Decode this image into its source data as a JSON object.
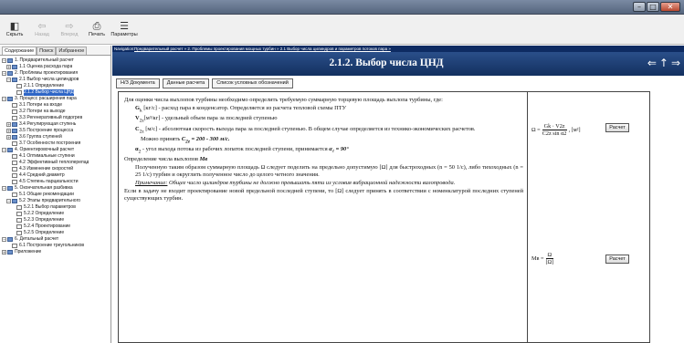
{
  "window": {
    "controls": [
      "–",
      "□",
      "✕"
    ]
  },
  "toolbar": {
    "buttons": [
      {
        "label": "Скрыть",
        "icon": "hide-panel-icon",
        "glyph": "◧",
        "enabled": true
      },
      {
        "label": "Назад",
        "icon": "back-arrow-icon",
        "glyph": "⇦",
        "enabled": false
      },
      {
        "label": "Вперед",
        "icon": "forward-arrow-icon",
        "glyph": "⇨",
        "enabled": false
      },
      {
        "label": "Печать",
        "icon": "print-icon",
        "glyph": "⎙",
        "enabled": true
      },
      {
        "label": "Параметры",
        "icon": "options-icon",
        "glyph": "☰",
        "enabled": true
      }
    ]
  },
  "left_panel": {
    "tabs": [
      "Содержание",
      "Поиск",
      "Избранное"
    ],
    "tree": [
      {
        "label": "1. Предварительный расчет",
        "level": 0,
        "exp": "−",
        "icon": "book"
      },
      {
        "label": "1.1 Оценка расхода пара",
        "level": 1,
        "exp": "+",
        "icon": "book"
      },
      {
        "label": "2. Проблемы проектирования",
        "level": 0,
        "exp": "−",
        "icon": "book"
      },
      {
        "label": "2.1 Выбор числа цилиндров",
        "level": 1,
        "exp": "−",
        "icon": "book"
      },
      {
        "label": "2.1.1 Определение",
        "level": 2,
        "exp": "",
        "icon": "page"
      },
      {
        "label": "2.1.2 Выбор числа ЦНД",
        "level": 2,
        "exp": "",
        "icon": "page",
        "selected": true
      },
      {
        "label": "3. Процесс расширения пара",
        "level": 0,
        "exp": "−",
        "icon": "book"
      },
      {
        "label": "3.1 Потери на входе",
        "level": 1,
        "exp": "",
        "icon": "page"
      },
      {
        "label": "3.2 Потери на выходе",
        "level": 1,
        "exp": "",
        "icon": "page"
      },
      {
        "label": "3.3 Регенеративный подогрев",
        "level": 1,
        "exp": "",
        "icon": "page"
      },
      {
        "label": "3.4 Регулирующая ступень",
        "level": 1,
        "exp": "+",
        "icon": "book"
      },
      {
        "label": "3.5 Построение процесса",
        "level": 1,
        "exp": "+",
        "icon": "book"
      },
      {
        "label": "3.6 Группа ступеней",
        "level": 1,
        "exp": "+",
        "icon": "book"
      },
      {
        "label": "3.7 Особенности построения",
        "level": 1,
        "exp": "",
        "icon": "page"
      },
      {
        "label": "4. Ориентировочный расчет",
        "level": 0,
        "exp": "−",
        "icon": "book"
      },
      {
        "label": "4.1 Оптимальные ступени",
        "level": 1,
        "exp": "",
        "icon": "page"
      },
      {
        "label": "4.2 Эффективный теплоперепад",
        "level": 1,
        "exp": "",
        "icon": "page"
      },
      {
        "label": "4.3 Изменение скоростей",
        "level": 1,
        "exp": "",
        "icon": "page"
      },
      {
        "label": "4.4 Средний диаметр",
        "level": 1,
        "exp": "",
        "icon": "page"
      },
      {
        "label": "4.5 Степень парциальности",
        "level": 1,
        "exp": "",
        "icon": "page"
      },
      {
        "label": "5. Окончательная разбивка",
        "level": 0,
        "exp": "−",
        "icon": "book"
      },
      {
        "label": "5.1 Общие рекомендации",
        "level": 1,
        "exp": "",
        "icon": "page"
      },
      {
        "label": "5.2 Этапы предварительного",
        "level": 1,
        "exp": "−",
        "icon": "book"
      },
      {
        "label": "5.2.1 Выбор параметров",
        "level": 2,
        "exp": "",
        "icon": "page"
      },
      {
        "label": "5.2.2 Определение",
        "level": 2,
        "exp": "",
        "icon": "page"
      },
      {
        "label": "5.2.3 Определение",
        "level": 2,
        "exp": "",
        "icon": "page"
      },
      {
        "label": "5.2.4 Проектирование",
        "level": 2,
        "exp": "",
        "icon": "page"
      },
      {
        "label": "5.2.5 Определение",
        "level": 2,
        "exp": "",
        "icon": "page"
      },
      {
        "label": "6. Детальный расчет",
        "level": 0,
        "exp": "−",
        "icon": "book"
      },
      {
        "label": "6.1 Построение треугольников",
        "level": 1,
        "exp": "",
        "icon": "page"
      },
      {
        "label": "Приложение",
        "level": 0,
        "exp": "+",
        "icon": "book"
      }
    ]
  },
  "main": {
    "nav_label": "Navigation:",
    "breadcrumb": "Предварительный расчет » 2. Проблемы проектирования мощных турбин » 2.1 Выбор числа цилиндров и параметров потоков пара »",
    "title": "2.1.2. Выбор числа ЦНД",
    "tabs": [
      "Н/З Документа",
      "Данные расчета",
      "Список условных обозначений"
    ],
    "calc_button": "Расчет",
    "text": {
      "p1": "Для оценки числа выхлопов турбины необходимо определить требуемую суммарную торцевую площадь выхлопа турбины, где:",
      "g_sym": "G",
      "g_sub": "k",
      "g_rest": " [кг/с] - расход пара в конденсатор. Определяется из расчета тепловой схемы ПТУ",
      "v_sym": "V",
      "v_sub": "2z",
      "v_rest": "[м³/кг] - удельный объем пара за последней ступенью",
      "c_sym": "C",
      "c_sub": "2z",
      "c_rest": " [м/с] - абсолютная скорость выхода пара за последней ступенью. В общем случае определяется из технико-экономических расчетов.",
      "can_take": "Можно принять ",
      "c_value": "C",
      "c_value_sub": "2z",
      "c_value_rest": " = 200 - 300 м/с.",
      "alpha_sym": "α",
      "alpha_sub": "2",
      "alpha_text": " - угол выхода потока из рабочих лопаток последней ступени, принимается ",
      "alpha_value": "α₂ = 90°",
      "p_number": "Определение числа выхлопов ",
      "p_number_sym": "Mв",
      "p2": "Полученную таким образом суммарную площадь Ω следует поделить на предельно допустимую [Ω] для быстроходных (n = 50 1/с), либо тихоходных (n = 25 1/с) турбин и округлить полученное число до целого четного значения.",
      "note_label": "Примечание:",
      "note_text": " Общее число цилиндров турбины не должно превышать пяти из условия вибрационной надежности валопровода.",
      "p3": "Если в задачу не входит проектирование новой предельной последней ступени, то [Ω] следует принять в соответствии с номенклатурой последних ступеней существующих турбин."
    },
    "formula1": {
      "lhs": "Ω =",
      "num": "Gk · V2z",
      "den": "C2z sin α2",
      "unit": ", [м²]"
    },
    "formula2": {
      "lhs": "Mв =",
      "num": "Ω",
      "den": "[Ω]"
    }
  }
}
